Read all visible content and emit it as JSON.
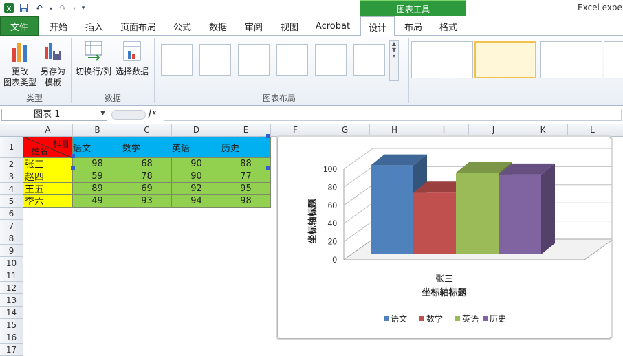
{
  "window": {
    "title": "Excel expe",
    "context_tab": "图表工具"
  },
  "tabs": [
    {
      "label": "文件"
    },
    {
      "label": "开始"
    },
    {
      "label": "插入"
    },
    {
      "label": "页面布局"
    },
    {
      "label": "公式"
    },
    {
      "label": "数据"
    },
    {
      "label": "审阅"
    },
    {
      "label": "视图"
    },
    {
      "label": "Acrobat"
    },
    {
      "label": "设计"
    },
    {
      "label": "布局"
    },
    {
      "label": "格式"
    }
  ],
  "ribbon": {
    "change_type_line1": "更改",
    "change_type_line2": "图表类型",
    "save_template_line1": "另存为",
    "save_template_line2": "模板",
    "switch_rowcol": "切换行/列",
    "select_data": "选择数据",
    "group_type": "类型",
    "group_data": "数据",
    "group_layout": "图表布局"
  },
  "formula": {
    "name_box": "图表 1",
    "fx": "fx"
  },
  "sheet": {
    "columns": [
      "A",
      "B",
      "C",
      "D",
      "E",
      "F",
      "G",
      "H",
      "I",
      "J",
      "K",
      "L"
    ],
    "rows": [
      "1",
      "2",
      "3",
      "4",
      "5",
      "6",
      "7",
      "8",
      "9",
      "10",
      "11",
      "12",
      "13",
      "14",
      "15",
      "16",
      "17"
    ],
    "header_diag_top": "科目",
    "header_diag_bottom": "姓名",
    "subjects": [
      "语文",
      "数学",
      "英语",
      "历史"
    ],
    "students": [
      {
        "name": "张三",
        "scores": [
          "98",
          "68",
          "90",
          "88"
        ]
      },
      {
        "name": "赵四",
        "scores": [
          "59",
          "78",
          "90",
          "77"
        ]
      },
      {
        "name": "王五",
        "scores": [
          "89",
          "69",
          "92",
          "95"
        ]
      },
      {
        "name": "李六",
        "scores": [
          "49",
          "93",
          "94",
          "98"
        ]
      }
    ]
  },
  "chart_data": {
    "type": "bar",
    "categories": [
      "张三"
    ],
    "series": [
      {
        "name": "语文",
        "values": [
          98
        ],
        "color": "#4f81bd"
      },
      {
        "name": "数学",
        "values": [
          68
        ],
        "color": "#c0504d"
      },
      {
        "name": "英语",
        "values": [
          90
        ],
        "color": "#9bbb59"
      },
      {
        "name": "历史",
        "values": [
          88
        ],
        "color": "#8064a2"
      }
    ],
    "xlabel": "坐标轴标题",
    "ylabel": "坐标轴标题",
    "yticks": [
      "0",
      "20",
      "40",
      "60",
      "80",
      "100"
    ],
    "ylim": [
      0,
      100
    ],
    "legend": "bottom",
    "grid": true,
    "style": "3d-column"
  },
  "colors": {
    "header_red": "#ff0000",
    "header_blue": "#00b0f0",
    "name_yellow": "#ffff00",
    "score_green": "#92d050",
    "excel_green": "#2e8d3a"
  }
}
